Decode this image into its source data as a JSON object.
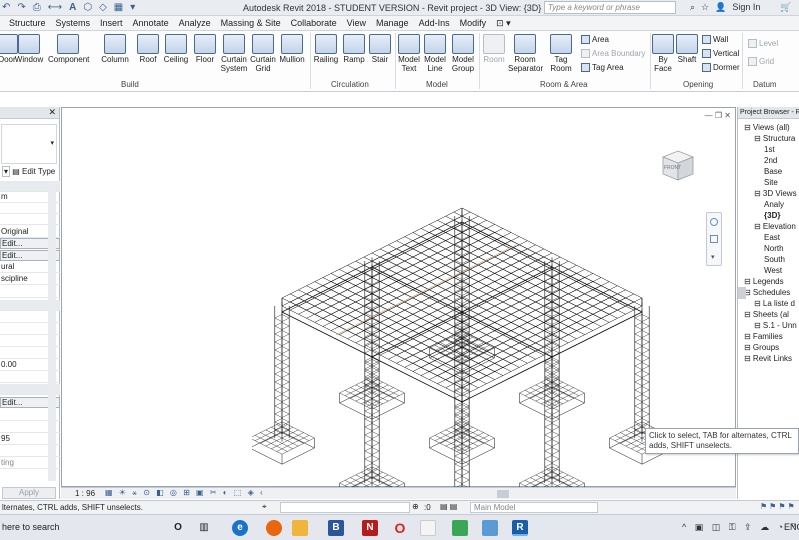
{
  "app": {
    "title": "Autodesk Revit 2018 - STUDENT VERSION -    Revit project - 3D View: {3D}",
    "search_placeholder": "Type a keyword or phrase",
    "sign_in": "Sign In"
  },
  "tabs": [
    "Structure",
    "Systems",
    "Insert",
    "Annotate",
    "Analyze",
    "Massing & Site",
    "Collaborate",
    "View",
    "Manage",
    "Add-Ins",
    "Modify"
  ],
  "ribbon": {
    "build": {
      "label": "Build",
      "buttons": [
        "Door",
        "Window",
        "Component",
        "Column",
        "Roof",
        "Ceiling",
        "Floor",
        "Curtain System",
        "Curtain Grid",
        "Mullion"
      ]
    },
    "circulation": {
      "label": "Circulation",
      "buttons": [
        "Railing",
        "Ramp",
        "Stair"
      ]
    },
    "model": {
      "label": "Model",
      "buttons": [
        "Model Text",
        "Model Line",
        "Model Group"
      ]
    },
    "room_area": {
      "label": "Room & Area",
      "buttons": [
        "Room",
        "Room Separator",
        "Tag Room"
      ],
      "small": [
        "Area",
        "Area Boundary",
        "Tag Area"
      ]
    },
    "opening": {
      "label": "Opening",
      "buttons": [
        "By Face",
        "Shaft"
      ],
      "small": [
        "Wall",
        "Vertical",
        "Dormer"
      ]
    },
    "datum": {
      "label": "Datum",
      "small": [
        "Level",
        "Grid"
      ]
    }
  },
  "properties": {
    "edit_type": "Edit Type",
    "rows": [
      "m",
      "",
      "",
      "Original",
      "Edit...",
      "Edit...",
      "ural",
      "scipline",
      "",
      "",
      "",
      "",
      "",
      "0.00",
      "",
      "",
      "Edit...",
      "",
      "",
      "95",
      "",
      "ting"
    ],
    "apply": "Apply"
  },
  "browser": {
    "header": "Project Browser - R",
    "items": [
      {
        "label": "Views (all)",
        "indent": 0,
        "bold": false
      },
      {
        "label": "Structura",
        "indent": 1,
        "bold": false
      },
      {
        "label": "1st",
        "indent": 2,
        "bold": false
      },
      {
        "label": "2nd",
        "indent": 2,
        "bold": false
      },
      {
        "label": "Base",
        "indent": 2,
        "bold": false
      },
      {
        "label": "Site",
        "indent": 2,
        "bold": false
      },
      {
        "label": "3D Views",
        "indent": 1,
        "bold": false
      },
      {
        "label": "Analy",
        "indent": 2,
        "bold": false
      },
      {
        "label": "{3D}",
        "indent": 2,
        "bold": true
      },
      {
        "label": "Elevation",
        "indent": 1,
        "bold": false
      },
      {
        "label": "East",
        "indent": 2,
        "bold": false
      },
      {
        "label": "North",
        "indent": 2,
        "bold": false
      },
      {
        "label": "South",
        "indent": 2,
        "bold": false
      },
      {
        "label": "West",
        "indent": 2,
        "bold": false
      },
      {
        "label": "Legends",
        "indent": 0,
        "bold": false
      },
      {
        "label": "Schedules",
        "indent": 0,
        "bold": false
      },
      {
        "label": "La liste d",
        "indent": 1,
        "bold": false
      },
      {
        "label": "Sheets (al",
        "indent": 0,
        "bold": false
      },
      {
        "label": "S.1 - Unn",
        "indent": 1,
        "bold": false
      },
      {
        "label": "Families",
        "indent": 0,
        "bold": false
      },
      {
        "label": "Groups",
        "indent": 0,
        "bold": false
      },
      {
        "label": "Revit Links",
        "indent": 0,
        "bold": false
      }
    ]
  },
  "viewcube": {
    "face": "FRONT"
  },
  "viewbar": {
    "scale": "1 : 96"
  },
  "status": {
    "message": "lternates, CTRL adds, SHIFT unselects.",
    "workset": ":0",
    "model": "Main Model"
  },
  "tooltip": "Click to select, TAB for alternates, CTRL adds, SHIFT unselects.",
  "taskbar": {
    "search": "here to search",
    "lang": "ENG"
  },
  "colors": {
    "accent": "#3b5f8f",
    "ribbon_bg": "#fdfdfd",
    "selection": "#c8a070"
  }
}
